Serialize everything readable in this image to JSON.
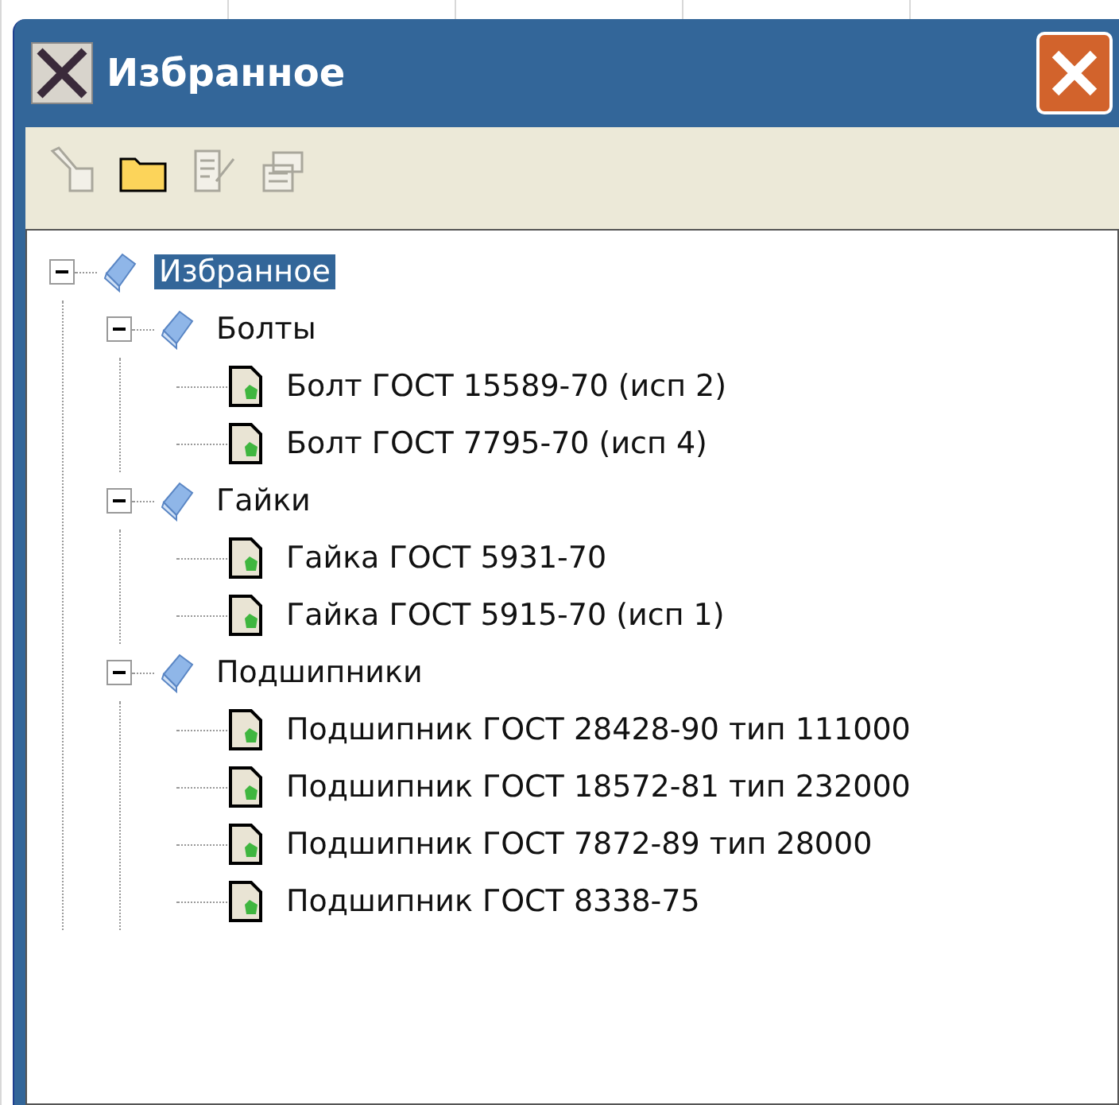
{
  "window": {
    "title": "Избранное"
  },
  "toolbar": [
    {
      "kind": "filter",
      "disabled": true
    },
    {
      "kind": "folder",
      "disabled": false
    },
    {
      "kind": "edit",
      "disabled": true
    },
    {
      "kind": "stack",
      "disabled": true
    }
  ],
  "tree": [
    {
      "label": "Избранное",
      "kind": "group",
      "selected": true,
      "expanded": true,
      "children": [
        {
          "label": "Болты",
          "kind": "group",
          "selected": false,
          "expanded": true,
          "children": [
            {
              "label": "Болт ГОСТ 15589-70 (исп 2)",
              "kind": "item",
              "selected": false
            },
            {
              "label": "Болт ГОСТ 7795-70 (исп 4)",
              "kind": "item",
              "selected": false
            }
          ]
        },
        {
          "label": "Гайки",
          "kind": "group",
          "selected": false,
          "expanded": true,
          "children": [
            {
              "label": "Гайка ГОСТ 5931-70",
              "kind": "item",
              "selected": false
            },
            {
              "label": "Гайка ГОСТ 5915-70 (исп 1)",
              "kind": "item",
              "selected": false
            }
          ]
        },
        {
          "label": "Подшипники",
          "kind": "group",
          "selected": false,
          "expanded": true,
          "children": [
            {
              "label": "Подшипник ГОСТ 28428-90 тип 111000",
              "kind": "item",
              "selected": false
            },
            {
              "label": "Подшипник ГОСТ 18572-81 тип 232000",
              "kind": "item",
              "selected": false
            },
            {
              "label": "Подшипник ГОСТ 7872-89 тип 28000",
              "kind": "item",
              "selected": false
            },
            {
              "label": "Подшипник ГОСТ 8338-75",
              "kind": "item",
              "selected": false
            }
          ]
        }
      ]
    }
  ]
}
